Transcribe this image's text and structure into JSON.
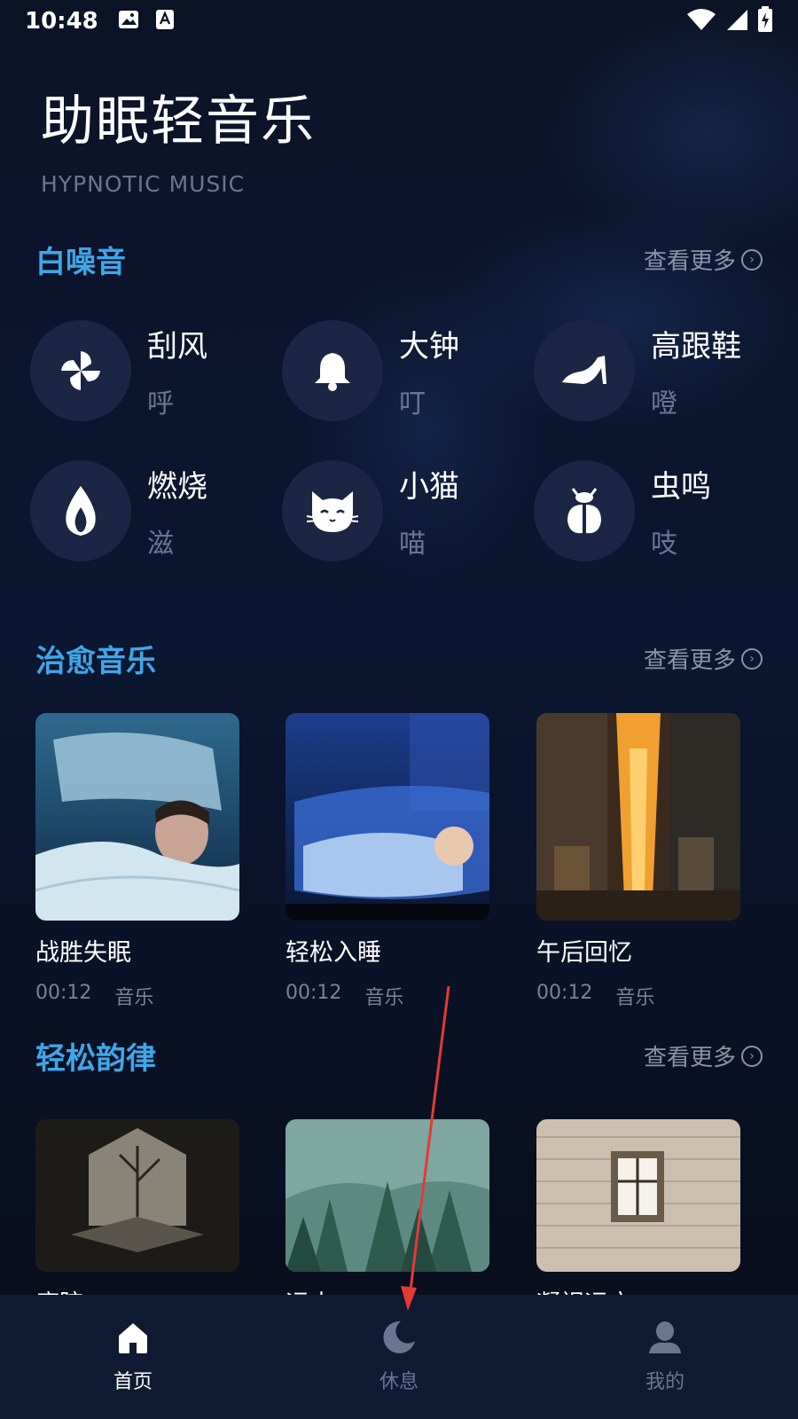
{
  "status_bar": {
    "time": "10:48"
  },
  "header": {
    "title": "助眠轻音乐",
    "subtitle": "HYPNOTIC MUSIC"
  },
  "sections": {
    "white_noise": {
      "title": "白噪音",
      "more_label": "查看更多"
    },
    "healing": {
      "title": "治愈音乐",
      "more_label": "查看更多"
    },
    "rhythm": {
      "title": "轻松韵律",
      "more_label": "查看更多"
    }
  },
  "white_noise_items": [
    {
      "name": "刮风",
      "sub": "呼",
      "icon": "pinwheel-icon"
    },
    {
      "name": "大钟",
      "sub": "叮",
      "icon": "bell-icon"
    },
    {
      "name": "高跟鞋",
      "sub": "噔",
      "icon": "high-heel-icon"
    },
    {
      "name": "燃烧",
      "sub": "滋",
      "icon": "flame-icon"
    },
    {
      "name": "小猫",
      "sub": "喵",
      "icon": "cat-icon"
    },
    {
      "name": "虫鸣",
      "sub": "吱",
      "icon": "beetle-icon"
    }
  ],
  "healing_cards": [
    {
      "title": "战胜失眠",
      "duration": "00:12",
      "tag": "音乐"
    },
    {
      "title": "轻松入睡",
      "duration": "00:12",
      "tag": "音乐"
    },
    {
      "title": "午后回忆",
      "duration": "00:12",
      "tag": "音乐"
    }
  ],
  "rhythm_cards": [
    {
      "title": "庭院"
    },
    {
      "title": "远山"
    },
    {
      "title": "凝视远方"
    }
  ],
  "bottom_nav": [
    {
      "label": "首页",
      "icon": "home-icon",
      "active": true
    },
    {
      "label": "休息",
      "icon": "moon-icon",
      "active": false
    },
    {
      "label": "我的",
      "icon": "user-icon",
      "active": false
    }
  ],
  "colors": {
    "accent": "#3fa6e8",
    "background": "#0a1022",
    "annotation_arrow": "#e53935"
  }
}
